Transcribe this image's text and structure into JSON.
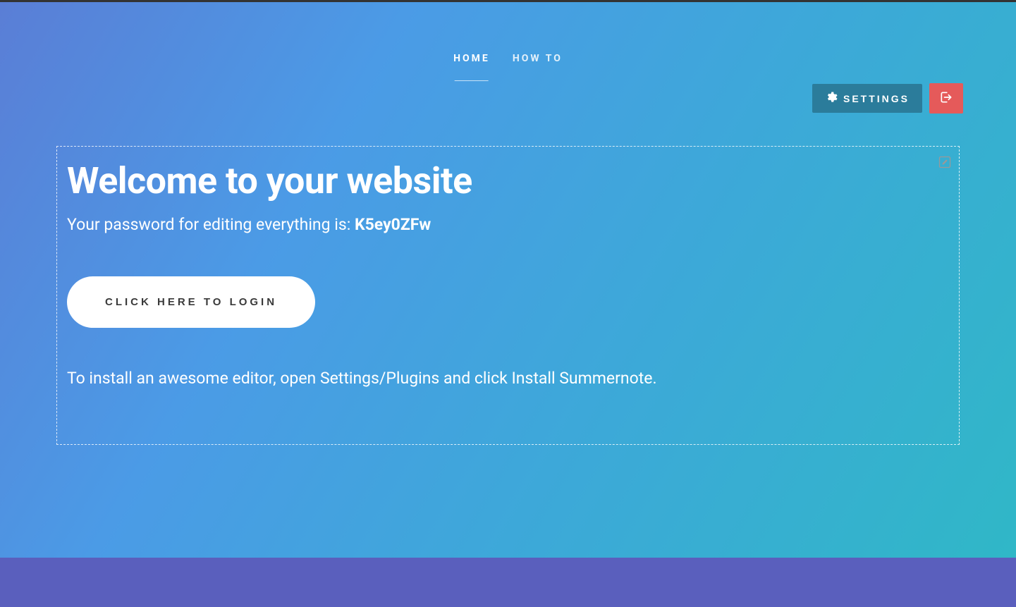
{
  "nav": {
    "items": [
      {
        "label": "HOME",
        "active": true
      },
      {
        "label": "HOW TO",
        "active": false
      }
    ]
  },
  "topRight": {
    "settingsLabel": "SETTINGS"
  },
  "content": {
    "title": "Welcome to your website",
    "passwordPrefix": "Your password for editing everything is: ",
    "passwordValue": "K5ey0ZFw",
    "loginButton": "CLICK HERE TO LOGIN",
    "installText": "To install an awesome editor, open Settings/Plugins and click Install Summernote."
  }
}
